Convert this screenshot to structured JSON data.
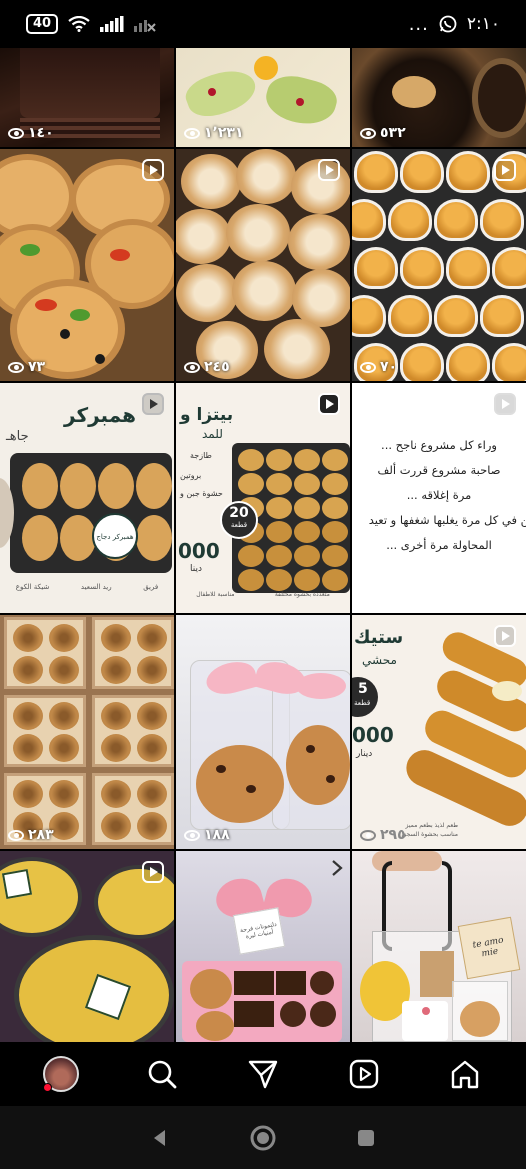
{
  "status_bar": {
    "battery": "40",
    "time": "٢:١٠",
    "overflow": "..."
  },
  "grid": {
    "tiles": [
      {
        "views": "١٤٠"
      },
      {
        "views": "١٬٢٣١"
      },
      {
        "views": "٥٣٢"
      },
      {
        "views": "٧٣"
      },
      {
        "views": "٢٤٥"
      },
      {
        "views": "٧٠"
      },
      {
        "title": "همبركر",
        "subtitle": "جاهـ",
        "badge": "همبركر دجاج",
        "footer": [
          "شيكة الكوع",
          "ريد السعيد",
          "فريق"
        ]
      },
      {
        "title": "بيتزا و",
        "subtitle": "للمد",
        "lines": [
          "طازجة",
          "بروتين",
          "حشوة جبن و"
        ],
        "count_label": "20",
        "count_unit": "قطعة",
        "price": "000",
        "currency": "دينا",
        "footer": [
          "مناسبة للاطفال",
          "متعددة بحشوة مختلفة"
        ]
      },
      {
        "quote": [
          "وراء كل مشروع ناجح ...",
          "صاحبة مشروع قررت ألف",
          "مرة إغلاقه ...",
          "لكن في كل مرة يغلبها شغفها و تعيد",
          "المحاولة مرة أخرى ..."
        ]
      },
      {
        "views": "٢٨٣"
      },
      {
        "views": "١٨٨"
      },
      {
        "title": "ستيك",
        "subtitle": "محشي",
        "count_label": "5",
        "count_unit": "قطعة",
        "price": "000",
        "currency": "دينار",
        "views": "٢٩٥",
        "footer": [
          "طعم لذيذ بطعم مميز",
          "مناسب بحشوة السجق"
        ]
      },
      {
        "views": ""
      },
      {
        "card_lines": [
          "دلتمونات فرحة",
          "أمنيات ليرة"
        ]
      },
      {
        "tag_text": [
          "te amo",
          "mie"
        ]
      }
    ]
  },
  "bottom_nav": {
    "icons": [
      "avatar",
      "search-icon",
      "direct-icon",
      "reels-icon",
      "home-icon"
    ]
  }
}
